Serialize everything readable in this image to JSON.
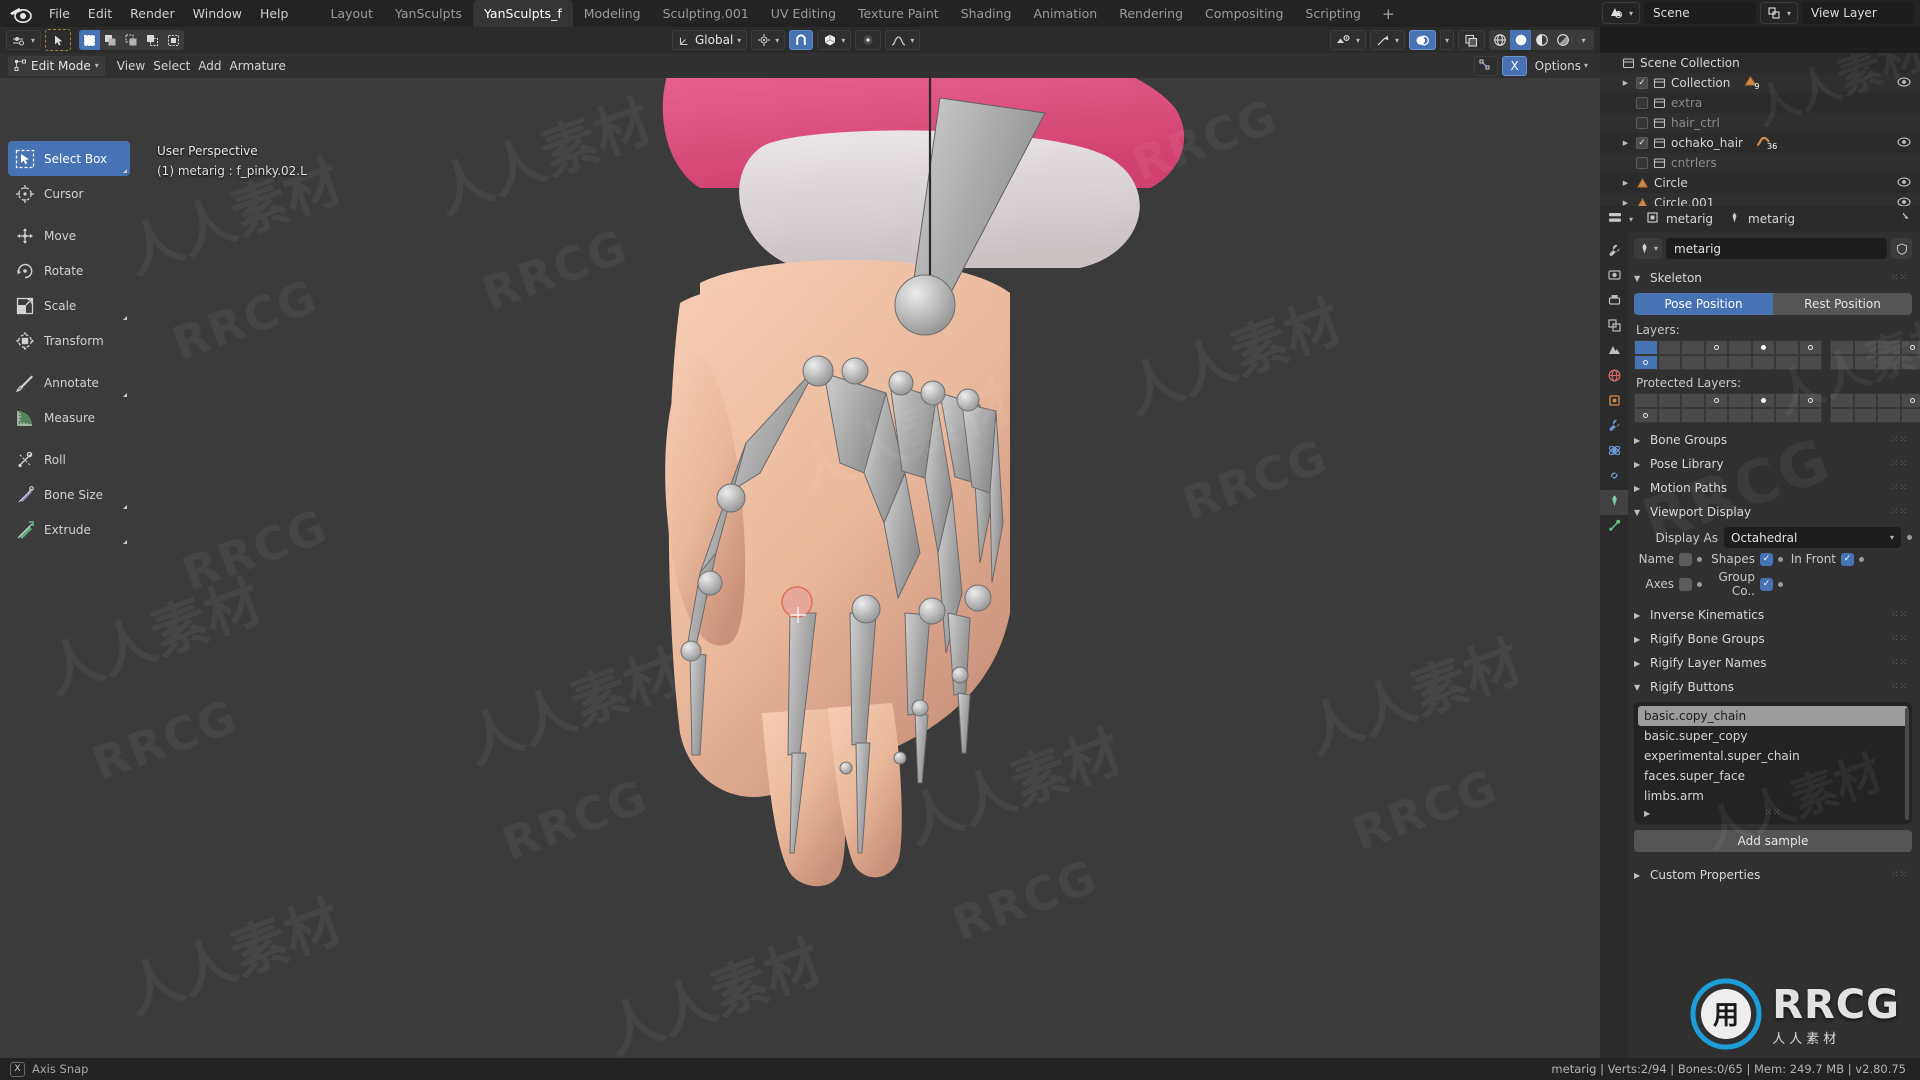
{
  "app": {
    "logo": "blender-logo"
  },
  "topbar": {
    "menus": [
      "File",
      "Edit",
      "Render",
      "Window",
      "Help"
    ],
    "tabs": [
      {
        "label": "Layout",
        "active": false
      },
      {
        "label": "YanSculpts",
        "active": false
      },
      {
        "label": "YanSculpts_f",
        "active": true
      },
      {
        "label": "Modeling",
        "active": false
      },
      {
        "label": "Sculpting.001",
        "active": false
      },
      {
        "label": "UV Editing",
        "active": false
      },
      {
        "label": "Texture Paint",
        "active": false
      },
      {
        "label": "Shading",
        "active": false
      },
      {
        "label": "Animation",
        "active": false
      },
      {
        "label": "Rendering",
        "active": false
      },
      {
        "label": "Compositing",
        "active": false
      },
      {
        "label": "Scripting",
        "active": false
      }
    ],
    "add_tab": "+",
    "scene_icon": "scene-icon",
    "scene_name": "Scene",
    "viewlayer_icon": "view-layer-icon",
    "viewlayer_name": "View Layer"
  },
  "viewport_header": {
    "mode": "Edit Mode",
    "menus": [
      "View",
      "Select",
      "Add",
      "Armature"
    ],
    "orientation": "Global",
    "pivot_icon": "pivot-point-icon",
    "snap_icon": "magnet-icon",
    "proportional_icon": "proportional-edit-icon",
    "falloff_icon": "falloff-curve-icon",
    "options_label": "Options",
    "xray_label": "X",
    "shading_icons": [
      "wireframe-icon",
      "solid-icon",
      "material-preview-icon",
      "rendered-icon"
    ],
    "overlay_icon": "overlays-icon",
    "gizmo_icon": "gizmo-icon",
    "visibility_icon": "object-types-visibility-icon"
  },
  "viewport": {
    "perspective": "User Perspective",
    "active_item": "(1) metarig : f_pinky.02.L"
  },
  "toolbar": {
    "tools": [
      {
        "label": "Select Box",
        "icon": "select-box-icon",
        "active": true,
        "corner": true
      },
      {
        "label": "Cursor",
        "icon": "cursor-icon",
        "active": false,
        "corner": false
      },
      {
        "label": "Move",
        "icon": "move-icon",
        "active": false,
        "corner": false
      },
      {
        "label": "Rotate",
        "icon": "rotate-icon",
        "active": false,
        "corner": false
      },
      {
        "label": "Scale",
        "icon": "scale-icon",
        "active": false,
        "corner": true
      },
      {
        "label": "Transform",
        "icon": "transform-icon",
        "active": false,
        "corner": false
      },
      {
        "label": "Annotate",
        "icon": "annotate-icon",
        "active": false,
        "corner": true
      },
      {
        "label": "Measure",
        "icon": "measure-icon",
        "active": false,
        "corner": false
      },
      {
        "label": "Roll",
        "icon": "roll-icon",
        "active": false,
        "corner": false
      },
      {
        "label": "Bone Size",
        "icon": "bone-size-icon",
        "active": false,
        "corner": true
      },
      {
        "label": "Extrude",
        "icon": "extrude-icon",
        "active": false,
        "corner": true
      }
    ]
  },
  "outliner": {
    "rows": [
      {
        "label": "Scene Collection",
        "type": "scene",
        "indent": 0,
        "disclosure": false,
        "checkbox": null,
        "dim": false,
        "eye": false,
        "badge": null
      },
      {
        "label": "Collection",
        "type": "collection",
        "indent": 1,
        "disclosure": true,
        "checkbox": true,
        "dim": false,
        "eye": true,
        "badge": "9",
        "badge_icon": "mesh-data-icon"
      },
      {
        "label": "extra",
        "type": "collection",
        "indent": 1,
        "disclosure": false,
        "checkbox": false,
        "dim": true,
        "eye": false,
        "badge": null
      },
      {
        "label": "hair_ctrl",
        "type": "collection",
        "indent": 1,
        "disclosure": false,
        "checkbox": false,
        "dim": true,
        "eye": false,
        "badge": null
      },
      {
        "label": "ochako_hair",
        "type": "collection",
        "indent": 1,
        "disclosure": true,
        "checkbox": true,
        "dim": false,
        "eye": true,
        "badge": "36",
        "badge_icon": "curve-data-icon"
      },
      {
        "label": "cntrlers",
        "type": "collection",
        "indent": 1,
        "disclosure": false,
        "checkbox": false,
        "dim": true,
        "eye": false,
        "badge": null
      },
      {
        "label": "Circle",
        "type": "object",
        "indent": 1,
        "disclosure": true,
        "checkbox": null,
        "dim": false,
        "eye": true,
        "badge": null
      },
      {
        "label": "Circle.001",
        "type": "object",
        "indent": 1,
        "disclosure": true,
        "checkbox": null,
        "dim": false,
        "eye": true,
        "badge": null
      }
    ]
  },
  "properties": {
    "breadcrumb": {
      "object": "metarig",
      "data": "metarig",
      "pin_icon": "pin-icon",
      "editor_icon": "properties-editor-icon"
    },
    "tabs": [
      {
        "name": "tool",
        "icon": "tool-icon",
        "active": false
      },
      {
        "name": "render",
        "icon": "render-icon",
        "active": false
      },
      {
        "name": "output",
        "icon": "output-icon",
        "active": false
      },
      {
        "name": "view-layer",
        "icon": "view-layer-icon",
        "active": false
      },
      {
        "name": "scene",
        "icon": "scene-icon",
        "active": false
      },
      {
        "name": "world",
        "icon": "world-icon",
        "active": false
      },
      {
        "name": "object",
        "icon": "object-icon",
        "active": false
      },
      {
        "name": "modifiers",
        "icon": "wrench-icon",
        "active": false
      },
      {
        "name": "physics",
        "icon": "physics-icon",
        "active": false
      },
      {
        "name": "constraints",
        "icon": "constraints-icon",
        "active": false
      },
      {
        "name": "object-data",
        "icon": "armature-data-icon",
        "active": true
      },
      {
        "name": "bone",
        "icon": "bone-icon",
        "active": false
      }
    ],
    "id_name": "metarig",
    "id_icon": "armature-data-icon",
    "shield_icon": "fake-user-icon",
    "skeleton": {
      "title": "Skeleton",
      "pose_position": "Pose Position",
      "rest_position": "Rest Position",
      "pose_active": true,
      "layers_label": "Layers:",
      "protected_label": "Protected Layers:",
      "layers_left_row1": [
        {
          "on": true,
          "dot": "none"
        },
        {
          "on": false,
          "dot": "none"
        },
        {
          "on": false,
          "dot": "none"
        },
        {
          "on": false,
          "dot": "ring"
        },
        {
          "on": false,
          "dot": "none"
        },
        {
          "on": false,
          "dot": "filled"
        },
        {
          "on": false,
          "dot": "none"
        },
        {
          "on": false,
          "dot": "ring"
        }
      ],
      "layers_left_row2": [
        {
          "on": true,
          "dot": "ring"
        },
        {
          "on": false,
          "dot": "none"
        },
        {
          "on": false,
          "dot": "none"
        },
        {
          "on": false,
          "dot": "none"
        },
        {
          "on": false,
          "dot": "none"
        },
        {
          "on": false,
          "dot": "none"
        },
        {
          "on": false,
          "dot": "none"
        },
        {
          "on": false,
          "dot": "none"
        }
      ],
      "layers_right_row1": [
        {
          "on": false,
          "dot": "none"
        },
        {
          "on": false,
          "dot": "none"
        },
        {
          "on": false,
          "dot": "none"
        },
        {
          "on": false,
          "dot": "ring"
        },
        {
          "on": false,
          "dot": "none"
        },
        {
          "on": false,
          "dot": "none"
        },
        {
          "on": false,
          "dot": "ring"
        },
        {
          "on": false,
          "dot": "none"
        }
      ],
      "layers_right_row2": [
        {
          "on": false,
          "dot": "none"
        },
        {
          "on": false,
          "dot": "none"
        },
        {
          "on": false,
          "dot": "none"
        },
        {
          "on": false,
          "dot": "none"
        },
        {
          "on": false,
          "dot": "none"
        },
        {
          "on": false,
          "dot": "none"
        },
        {
          "on": false,
          "dot": "none"
        },
        {
          "on": false,
          "dot": "none"
        }
      ],
      "protected_left_row1": [
        {
          "on": false,
          "dot": "none"
        },
        {
          "on": false,
          "dot": "none"
        },
        {
          "on": false,
          "dot": "none"
        },
        {
          "on": false,
          "dot": "ring"
        },
        {
          "on": false,
          "dot": "none"
        },
        {
          "on": false,
          "dot": "filled"
        },
        {
          "on": false,
          "dot": "none"
        },
        {
          "on": false,
          "dot": "ring"
        }
      ],
      "protected_left_row2": [
        {
          "on": false,
          "dot": "ring"
        },
        {
          "on": false,
          "dot": "none"
        },
        {
          "on": false,
          "dot": "none"
        },
        {
          "on": false,
          "dot": "none"
        },
        {
          "on": false,
          "dot": "none"
        },
        {
          "on": false,
          "dot": "none"
        },
        {
          "on": false,
          "dot": "none"
        },
        {
          "on": false,
          "dot": "none"
        }
      ],
      "protected_right_row1": [
        {
          "on": false,
          "dot": "none"
        },
        {
          "on": false,
          "dot": "none"
        },
        {
          "on": false,
          "dot": "none"
        },
        {
          "on": false,
          "dot": "ring"
        },
        {
          "on": false,
          "dot": "none"
        },
        {
          "on": false,
          "dot": "none"
        },
        {
          "on": false,
          "dot": "ring"
        },
        {
          "on": false,
          "dot": "none"
        }
      ],
      "protected_right_row2": [
        {
          "on": false,
          "dot": "none"
        },
        {
          "on": false,
          "dot": "none"
        },
        {
          "on": false,
          "dot": "none"
        },
        {
          "on": false,
          "dot": "none"
        },
        {
          "on": false,
          "dot": "none"
        },
        {
          "on": false,
          "dot": "none"
        },
        {
          "on": false,
          "dot": "none"
        },
        {
          "on": false,
          "dot": "none"
        }
      ]
    },
    "collapsed_panels_a": [
      "Bone Groups",
      "Pose Library",
      "Motion Paths"
    ],
    "viewport_display": {
      "title": "Viewport Display",
      "display_as_label": "Display As",
      "display_as_value": "Octahedral",
      "name_label": "Name",
      "name_checked": false,
      "shapes_label": "Shapes",
      "shapes_checked": true,
      "in_front_label": "In Front",
      "in_front_checked": true,
      "axes_label": "Axes",
      "axes_checked": false,
      "group_colors_label": "Group Co..",
      "group_colors_checked": true
    },
    "collapsed_panels_b": [
      "Inverse Kinematics",
      "Rigify Bone Groups",
      "Rigify Layer Names"
    ],
    "rigify_buttons": {
      "title": "Rigify Buttons",
      "items": [
        {
          "label": "basic.copy_chain",
          "selected": true
        },
        {
          "label": "basic.super_copy",
          "selected": false
        },
        {
          "label": "experimental.super_chain",
          "selected": false
        },
        {
          "label": "faces.super_face",
          "selected": false
        },
        {
          "label": "limbs.arm",
          "selected": false
        }
      ],
      "add_sample_label": "Add sample"
    },
    "custom_properties": "Custom Properties"
  },
  "statusbar": {
    "key_label": "X",
    "action": "Axis Snap",
    "info": "metarig | Verts:2/94 | Bones:0/65 | Mem: 249.7 MB | v2.80.75"
  },
  "watermarks": {
    "cn": "人人素材",
    "en": "RRCG",
    "badge_title": "RRCG",
    "badge_sub": "人人素材"
  },
  "colors": {
    "accent": "#4772b3",
    "topbar_bg": "#232323",
    "viewport_bg": "#3b3b3b",
    "panel_bg": "#303030",
    "header_bg": "#2b2b2b"
  }
}
